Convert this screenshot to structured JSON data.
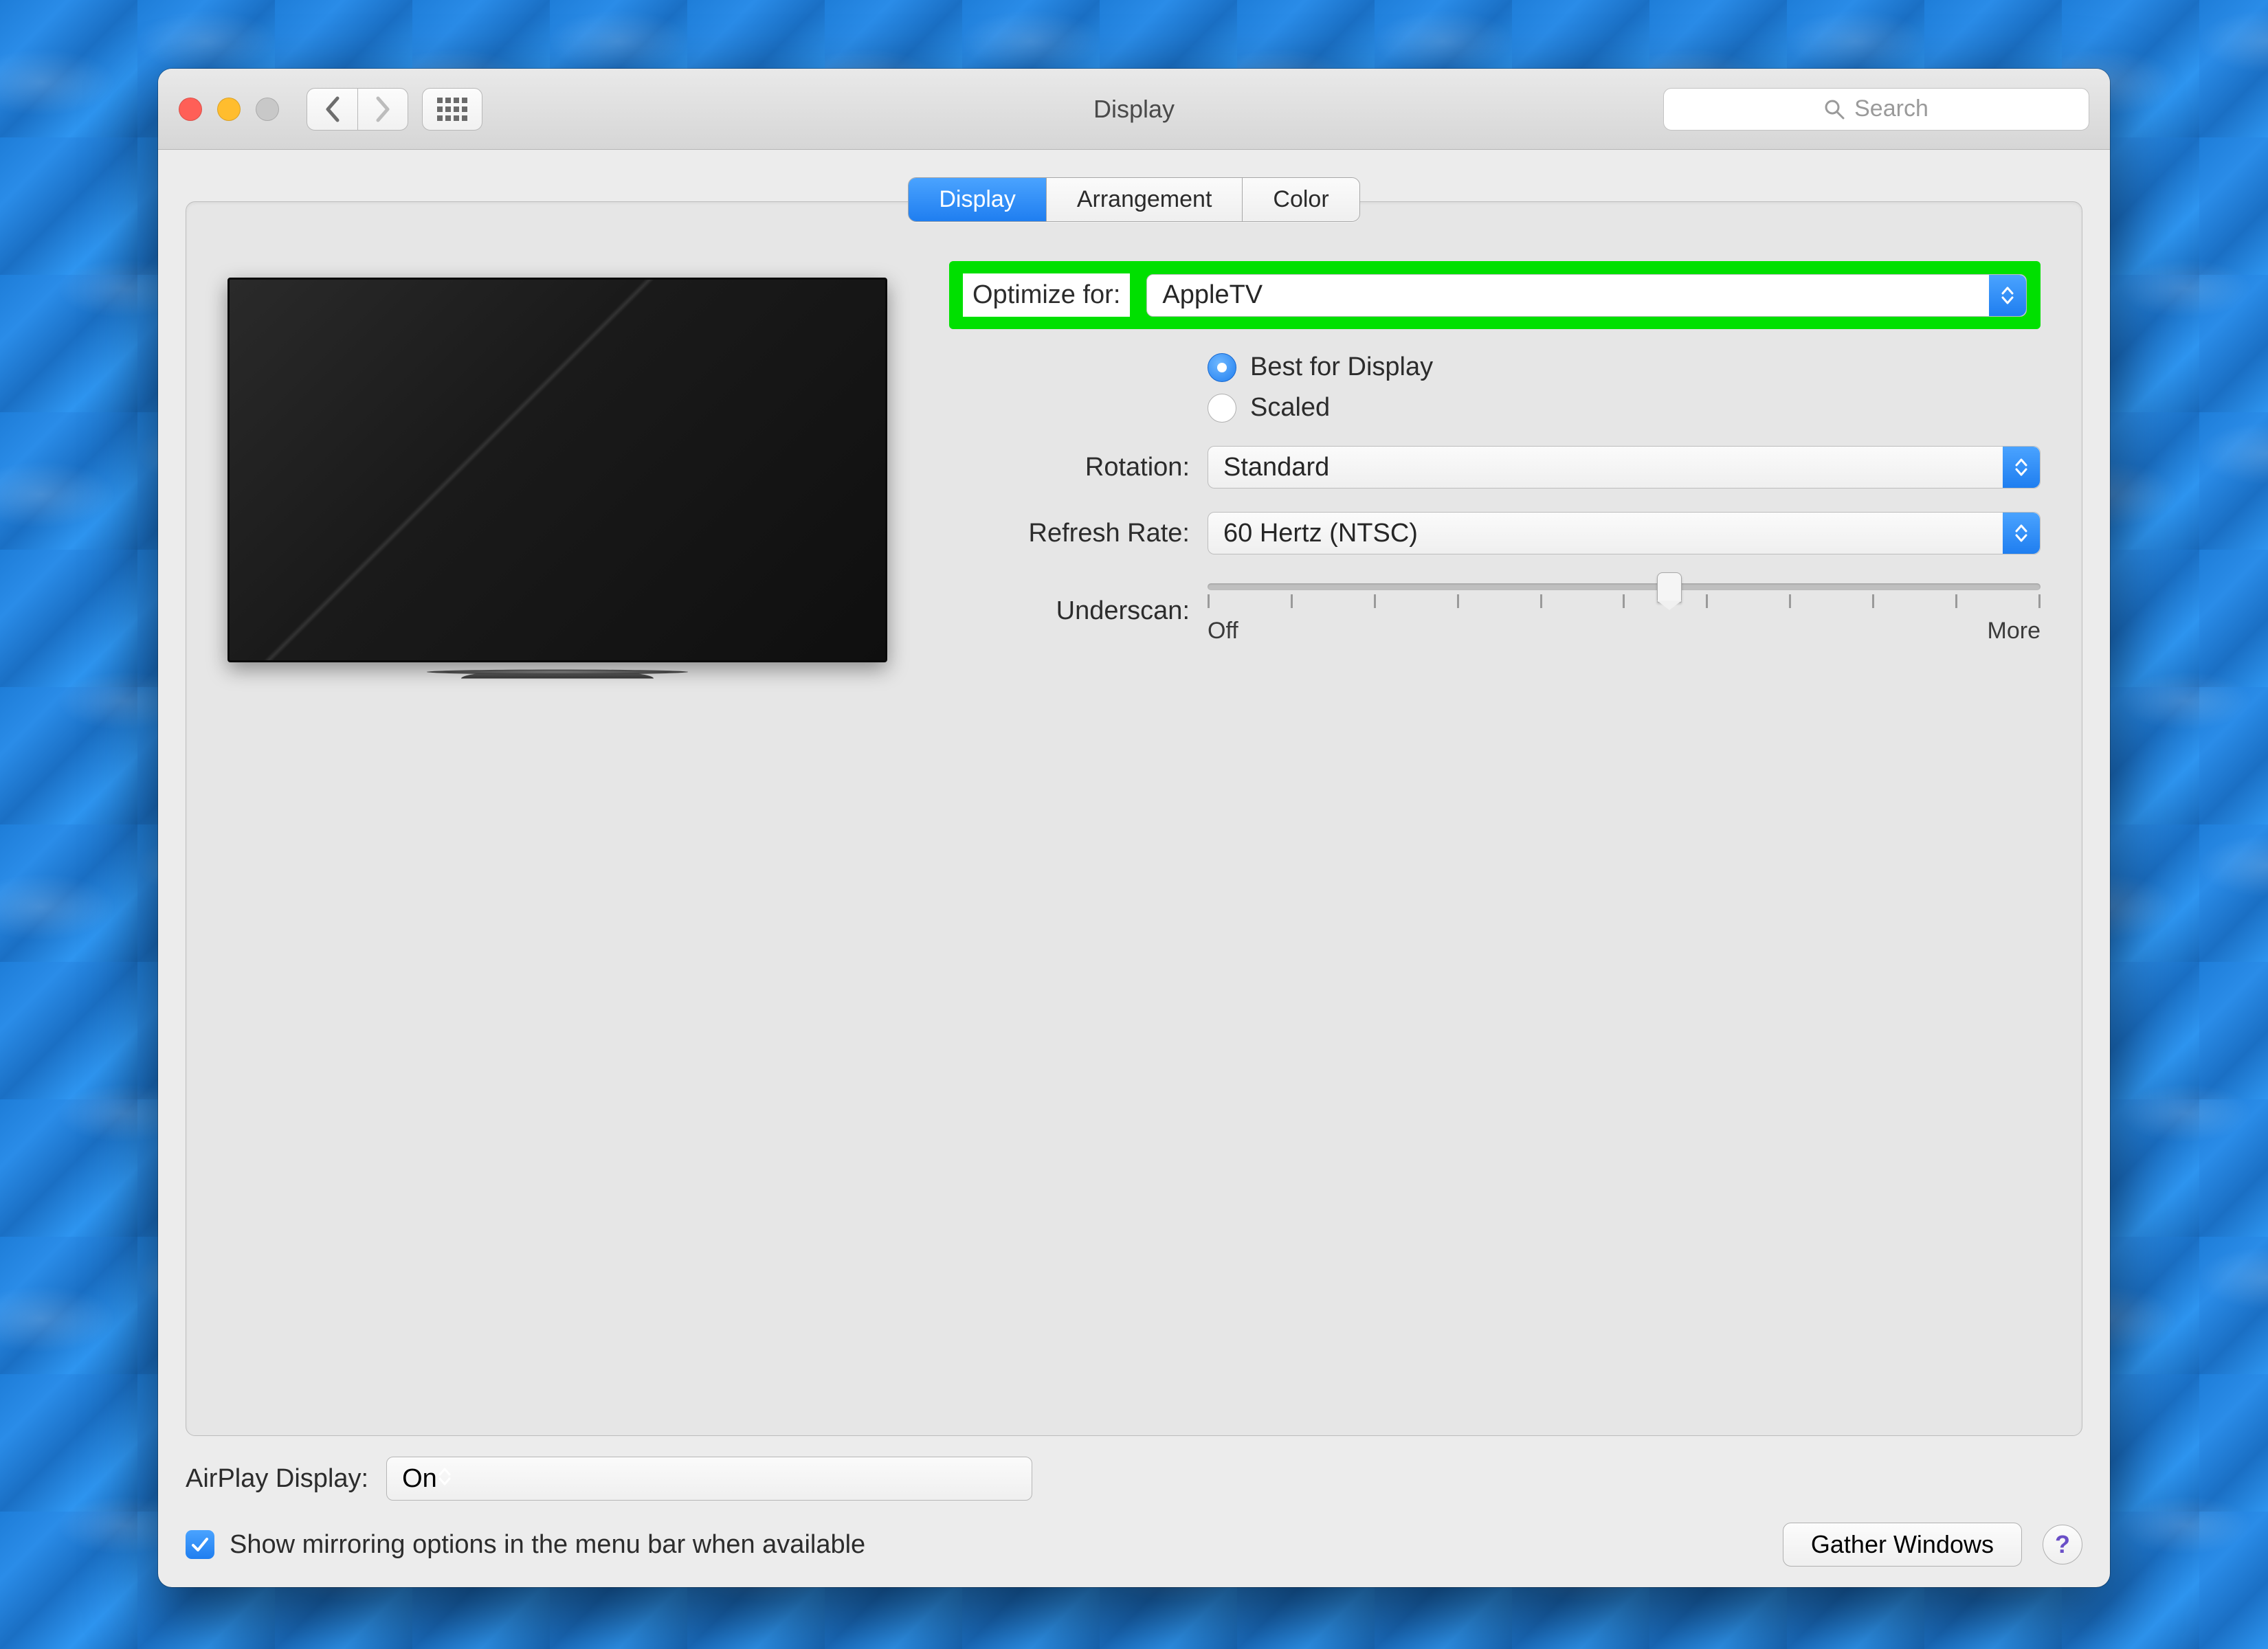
{
  "window": {
    "title": "Display"
  },
  "toolbar": {
    "search_placeholder": "Search"
  },
  "tabs": [
    "Display",
    "Arrangement",
    "Color"
  ],
  "active_tab": 0,
  "settings": {
    "optimize_label": "Optimize for:",
    "optimize_value": "AppleTV",
    "resolution": {
      "best_label": "Best for Display",
      "scaled_label": "Scaled",
      "selected": "best"
    },
    "rotation_label": "Rotation:",
    "rotation_value": "Standard",
    "refresh_label": "Refresh Rate:",
    "refresh_value": "60 Hertz (NTSC)",
    "underscan_label": "Underscan:",
    "underscan_min": "Off",
    "underscan_max": "More"
  },
  "footer": {
    "airplay_label": "AirPlay Display:",
    "airplay_value": "On",
    "mirror_label": "Show mirroring options in the menu bar when available",
    "gather_label": "Gather Windows",
    "help_label": "?"
  },
  "colors": {
    "accent": "#1f7ef0",
    "highlight": "#00e000"
  }
}
